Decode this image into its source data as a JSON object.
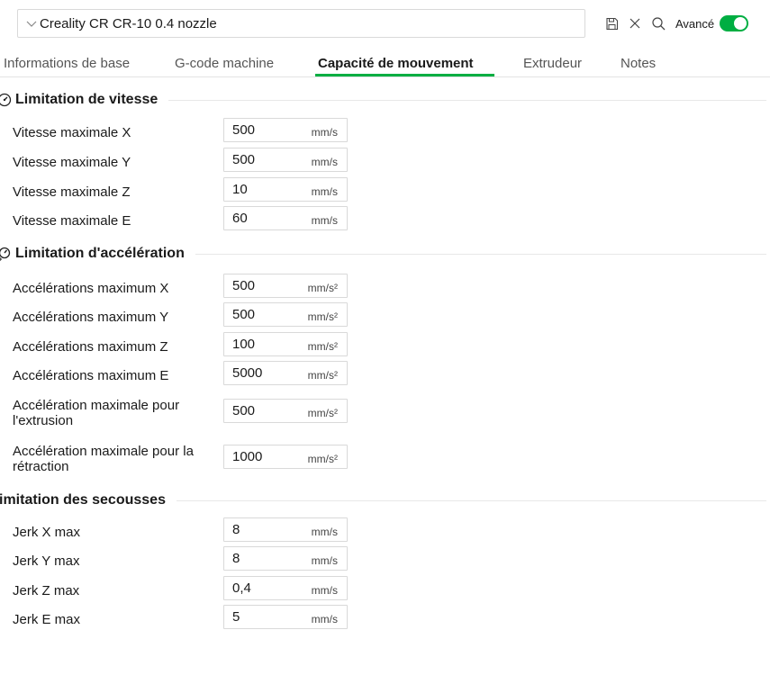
{
  "preset": {
    "name": "Creality CR CR-10 0.4 nozzle"
  },
  "toolbar": {
    "advanced_label": "Avancé",
    "advanced_on": true,
    "accent": "#00ae42"
  },
  "tabs": [
    {
      "label": "Informations de base",
      "active": false
    },
    {
      "label": "G-code machine",
      "active": false
    },
    {
      "label": "Capacité de mouvement",
      "active": true
    },
    {
      "label": "Extrudeur",
      "active": false
    },
    {
      "label": "Notes",
      "active": false
    }
  ],
  "speed": {
    "title": "Limitation de vitesse",
    "rows": [
      {
        "label": "Vitesse maximale X",
        "value": "500",
        "unit": "mm/s"
      },
      {
        "label": "Vitesse maximale Y",
        "value": "500",
        "unit": "mm/s"
      },
      {
        "label": "Vitesse maximale Z",
        "value": "10",
        "unit": "mm/s"
      },
      {
        "label": "Vitesse maximale E",
        "value": "60",
        "unit": "mm/s"
      }
    ]
  },
  "accel": {
    "title": "Limitation d'accélération",
    "rows": [
      {
        "label": "Accélérations maximum X",
        "value": "500",
        "unit": "mm/s²"
      },
      {
        "label": "Accélérations maximum Y",
        "value": "500",
        "unit": "mm/s²"
      },
      {
        "label": "Accélérations maximum Z",
        "value": "100",
        "unit": "mm/s²"
      },
      {
        "label": "Accélérations maximum E",
        "value": "5000",
        "unit": "mm/s²"
      },
      {
        "label": "Accélération maximale pour",
        "label2": "l'extrusion",
        "value": "500",
        "unit": "mm/s²"
      },
      {
        "label": "Accélération maximale pour la",
        "label2": "rétraction",
        "value": "1000",
        "unit": "mm/s²"
      }
    ]
  },
  "jerk": {
    "title": "imitation des secousses",
    "rows": [
      {
        "label": "Jerk X max",
        "value": "8",
        "unit": "mm/s"
      },
      {
        "label": "Jerk Y max",
        "value": "8",
        "unit": "mm/s"
      },
      {
        "label": "Jerk Z max",
        "value": "0,4",
        "unit": "mm/s"
      },
      {
        "label": "Jerk E max",
        "value": "5",
        "unit": "mm/s"
      }
    ]
  }
}
